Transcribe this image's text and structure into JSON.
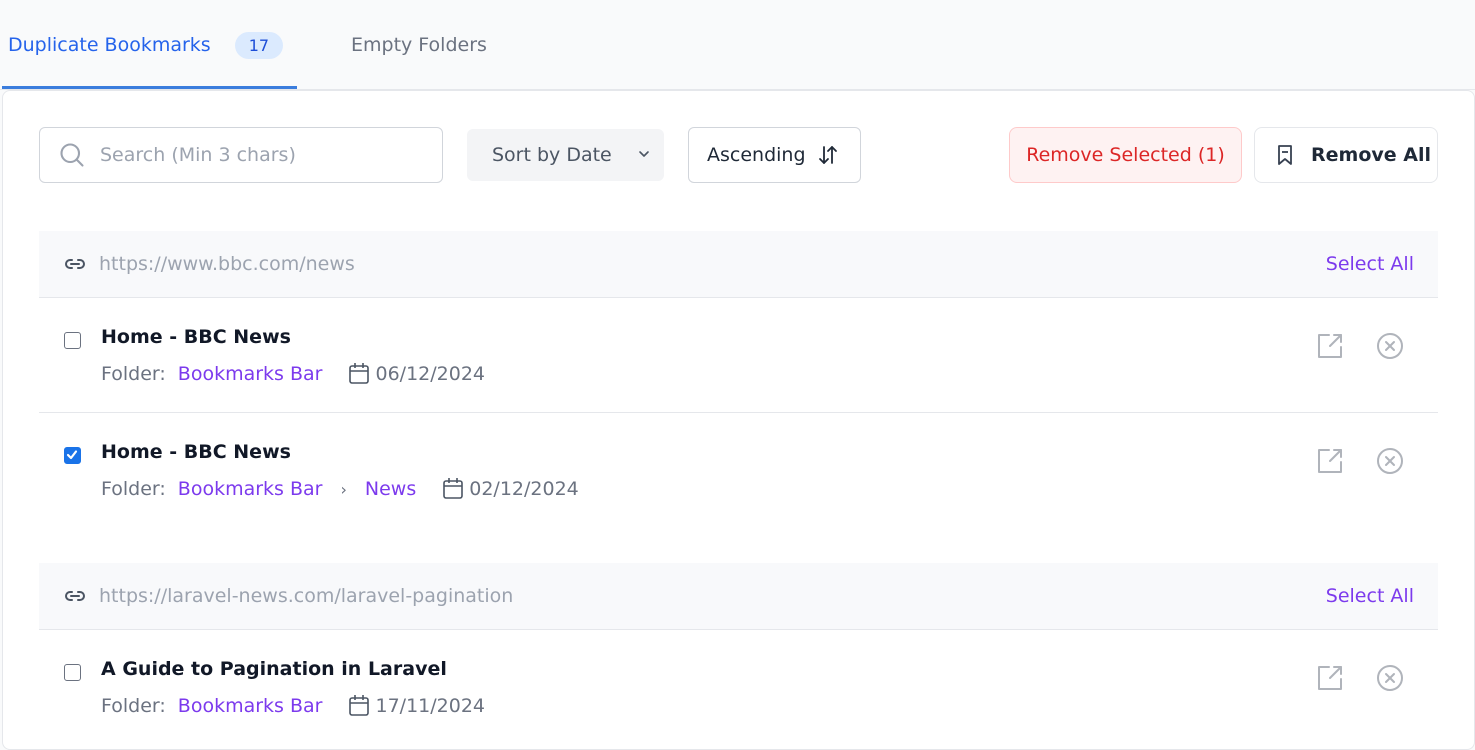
{
  "tabs": [
    {
      "label": "Duplicate Bookmarks",
      "count": "17",
      "active": true
    },
    {
      "label": "Empty Folders",
      "active": false
    }
  ],
  "toolbar": {
    "search_placeholder": "Search (Min 3 chars)",
    "search_value": "",
    "sort_selected": "Sort by Date",
    "order_label": "Ascending",
    "remove_selected_label": "Remove Selected (1)",
    "remove_all_label": "Remove All"
  },
  "groups": [
    {
      "url": "https://www.bbc.com/news",
      "select_all_label": "Select All",
      "items": [
        {
          "title": "Home - BBC News",
          "folder_label": "Folder:",
          "folder_path": [
            "Bookmarks Bar"
          ],
          "date": "06/12/2024",
          "checked": false
        },
        {
          "title": "Home - BBC News",
          "folder_label": "Folder:",
          "folder_path": [
            "Bookmarks Bar",
            "News"
          ],
          "date": "02/12/2024",
          "checked": true
        }
      ]
    },
    {
      "url": "https://laravel-news.com/laravel-pagination",
      "select_all_label": "Select All",
      "items": [
        {
          "title": "A Guide to Pagination in Laravel",
          "folder_label": "Folder:",
          "folder_path": [
            "Bookmarks Bar"
          ],
          "date": "17/11/2024",
          "checked": false
        }
      ]
    }
  ],
  "colors": {
    "accent": "#2563eb",
    "folder_link": "#7c3aed",
    "danger": "#dc2626"
  }
}
